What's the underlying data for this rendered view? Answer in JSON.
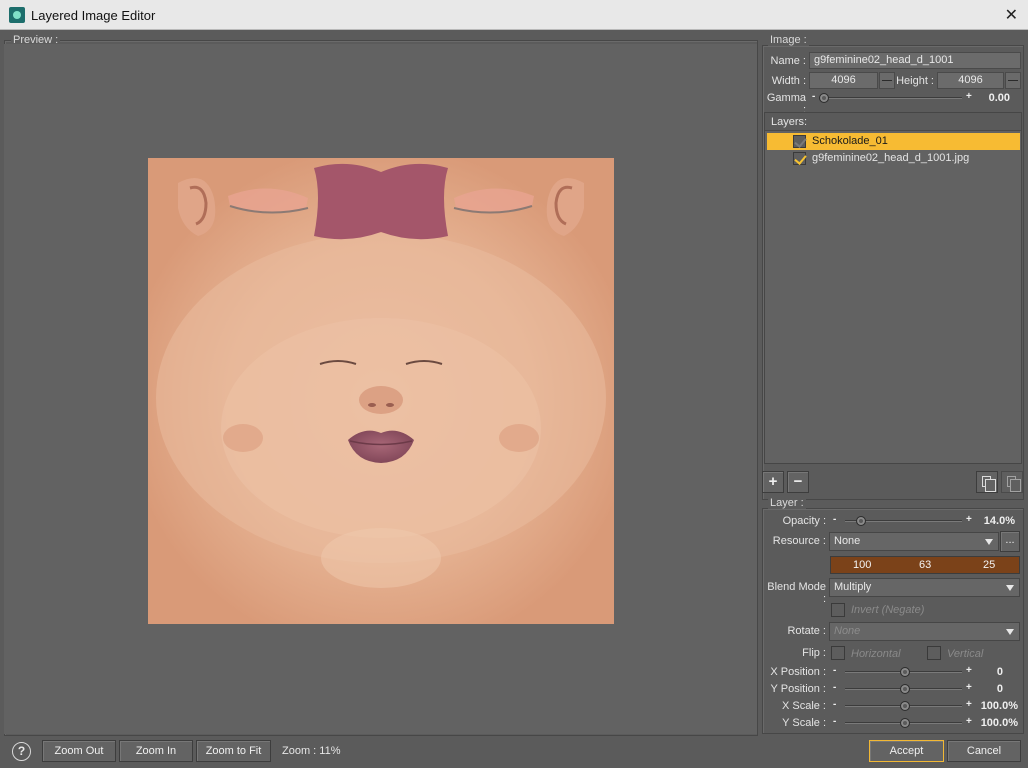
{
  "window": {
    "title": "Layered Image Editor",
    "close_glyph": "✕"
  },
  "preview": {
    "label": "Preview :"
  },
  "image": {
    "label": "Image :",
    "name_label": "Name :",
    "name_value": "g9feminine02_head_d_1001",
    "width_label": "Width :",
    "width_value": "4096",
    "height_label": "Height :",
    "height_value": "4096",
    "gamma_label": "Gamma :",
    "gamma_value": "0.00"
  },
  "layers": {
    "label": "Layers:",
    "items": [
      {
        "name": "Schokolade_01",
        "checked": true,
        "selected": true
      },
      {
        "name": "g9feminine02_head_d_1001.jpg",
        "checked": true,
        "selected": false
      }
    ],
    "add_label": "+",
    "remove_label": "−"
  },
  "layer": {
    "label": "Layer :",
    "opacity_label": "Opacity :",
    "opacity_value": "14.0%",
    "opacity_fraction": 0.14,
    "resource_label": "Resource :",
    "resource_value": "None",
    "resource_browse": "...",
    "color": {
      "r": "100",
      "g": "63",
      "b": "25",
      "hex": "#7b4219"
    },
    "blend_label": "Blend Mode :",
    "blend_value": "Multiply",
    "invert_label": "Invert (Negate)",
    "rotate_label": "Rotate :",
    "rotate_value": "None",
    "flip_label": "Flip :",
    "flip_horizontal": "Horizontal",
    "flip_vertical": "Vertical",
    "xpos_label": "X Position :",
    "xpos_value": "0",
    "ypos_label": "Y Position :",
    "ypos_value": "0",
    "xscale_label": "X Scale :",
    "xscale_value": "100.0%",
    "yscale_label": "Y Scale :",
    "yscale_value": "100.0%",
    "minus": "-",
    "plus": "+"
  },
  "footer": {
    "help": "?",
    "zoom_out": "Zoom Out",
    "zoom_in": "Zoom In",
    "zoom_fit": "Zoom to Fit",
    "zoom_text": "Zoom : 11%",
    "accept": "Accept",
    "cancel": "Cancel"
  },
  "colors": {
    "accent": "#f7bb33",
    "panel": "#5b5b5b",
    "skin": "#e7b393"
  }
}
